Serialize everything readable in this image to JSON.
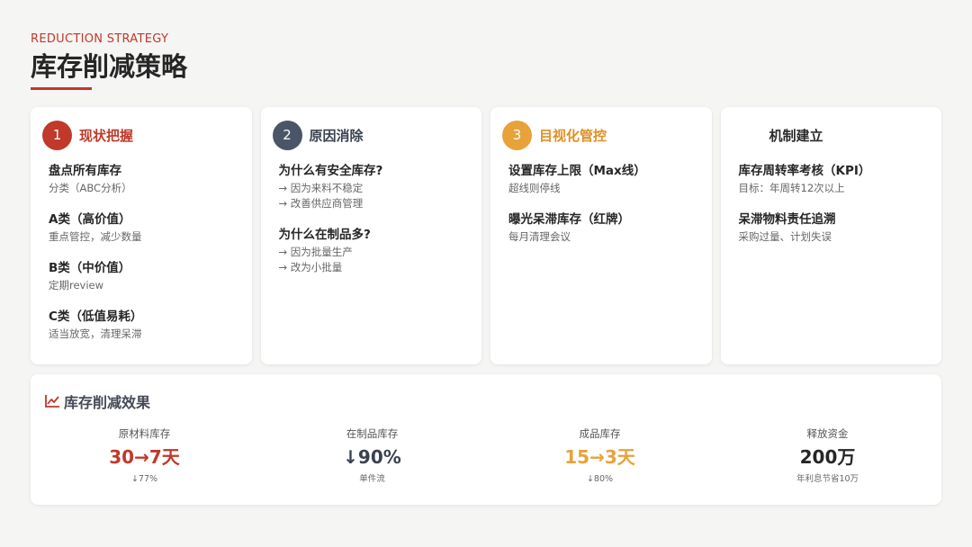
{
  "header": {
    "eyebrow": "REDUCTION STRATEGY",
    "title": "库存削减策略"
  },
  "colors": {
    "accent_red": "#c0392b",
    "slate": "#4a5568",
    "amber": "#e8a23a",
    "background": "#f5f5f4"
  },
  "cards": [
    {
      "number": "1",
      "title": "现状把握",
      "items": [
        {
          "title": "盘点所有库存",
          "lines": [
            "分类（ABC分析）"
          ]
        },
        {
          "title": "A类（高价值）",
          "lines": [
            "重点管控，减少数量"
          ]
        },
        {
          "title": "B类（中价值）",
          "lines": [
            "定期review"
          ]
        },
        {
          "title": "C类（低值易耗）",
          "lines": [
            "适当放宽，清理呆滞"
          ]
        }
      ]
    },
    {
      "number": "2",
      "title": "原因消除",
      "items": [
        {
          "title": "为什么有安全库存?",
          "lines": [
            "→ 因为来料不稳定",
            "→ 改善供应商管理"
          ]
        },
        {
          "title": "为什么在制品多?",
          "lines": [
            "→ 因为批量生产",
            "→ 改为小批量"
          ]
        }
      ]
    },
    {
      "number": "3",
      "title": "目视化管控",
      "items": [
        {
          "title": "设置库存上限（Max线）",
          "lines": [
            "超线则停线"
          ]
        },
        {
          "title": "曝光呆滞库存（红牌）",
          "lines": [
            "每月清理会议"
          ]
        }
      ]
    },
    {
      "number": "",
      "title": "机制建立",
      "items": [
        {
          "title": "库存周转率考核（KPI）",
          "lines": [
            "目标：年周转12次以上"
          ]
        },
        {
          "title": "呆滞物料责任追溯",
          "lines": [
            "采购过量、计划失误"
          ]
        }
      ]
    }
  ],
  "results": {
    "icon": "line-chart-icon",
    "title": "库存削减效果",
    "metrics": [
      {
        "label": "原材料库存",
        "value": "30→7天",
        "sub": "↓77%",
        "color": "#c0392b"
      },
      {
        "label": "在制品库存",
        "value": "↓90%",
        "sub": "单件流",
        "color": "#3a4150"
      },
      {
        "label": "成品库存",
        "value": "15→3天",
        "sub": "↓80%",
        "color": "#e8a23a"
      },
      {
        "label": "释放资金",
        "value": "200万",
        "sub": "年利息节省10万",
        "color": "#262626"
      }
    ]
  }
}
